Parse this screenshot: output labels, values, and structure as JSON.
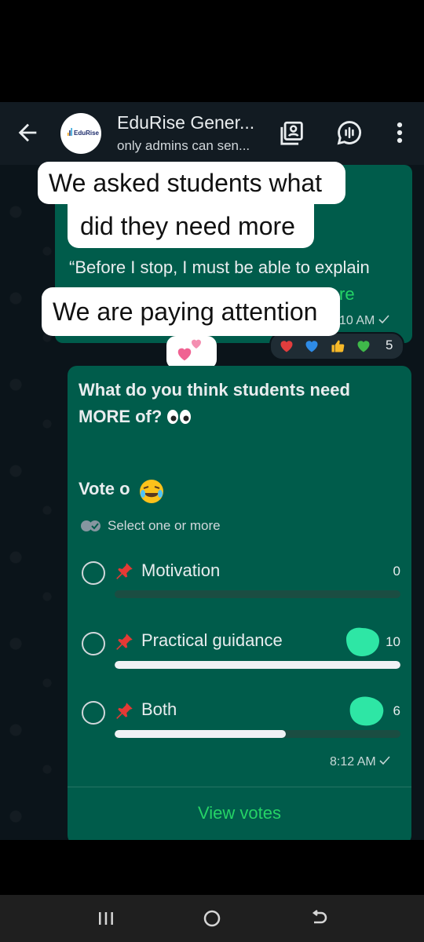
{
  "header": {
    "title": "EduRise Gener...",
    "subtitle": "only admins can sen...",
    "avatar_text": "EduRise"
  },
  "overlays": {
    "caption1_line1": "We asked students what",
    "caption1_line2": "did they need more",
    "caption2": "We are paying attention"
  },
  "message": {
    "quote_line1": "“Before I stop, I must be able to explain",
    "read_more_fragment": "re",
    "time": "10 AM",
    "reactions": [
      "red-heart",
      "blue-heart",
      "thumbs-up",
      "green-heart"
    ],
    "reaction_count": "5"
  },
  "poll": {
    "question": "What do you think students need MORE of?",
    "vote_text": "Vote o",
    "select_hint": "Select one or more",
    "options": [
      {
        "label": "Motivation",
        "count": "0",
        "fraction": 0.0
      },
      {
        "label": "Practical guidance",
        "count": "10",
        "fraction": 1.0
      },
      {
        "label": "Both",
        "count": "6",
        "fraction": 0.6
      }
    ],
    "time": "8:12 AM",
    "view_votes": "View votes"
  },
  "colors": {
    "chat_bg": "#0b141a",
    "bubble": "#005c4b",
    "accent": "#25d366",
    "header": "#121b22"
  }
}
